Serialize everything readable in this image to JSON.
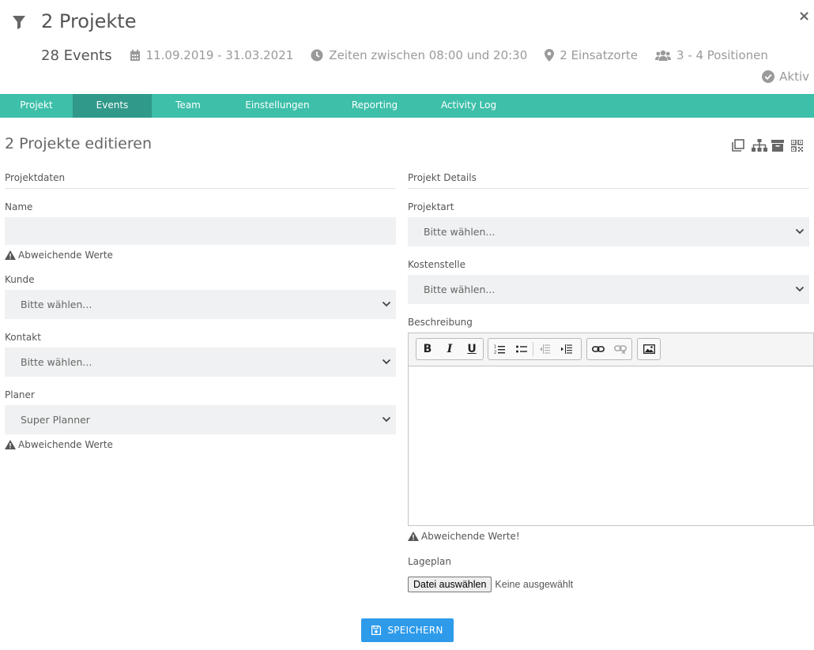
{
  "header": {
    "title": "2 Projekte",
    "events": "28 Events",
    "date_range": "11.09.2019 - 31.03.2021",
    "times": "Zeiten zwischen 08:00 und 20:30",
    "locations": "2 Einsatzorte",
    "positions": "3 - 4 Positionen",
    "status": "Aktiv",
    "close_label": "×"
  },
  "tabs": [
    {
      "label": "Projekt"
    },
    {
      "label": "Events"
    },
    {
      "label": "Team"
    },
    {
      "label": "Einstellungen"
    },
    {
      "label": "Reporting"
    },
    {
      "label": "Activity Log"
    }
  ],
  "active_tab": "Events",
  "page_title": "2 Projekte editieren",
  "left": {
    "section": "Projektdaten",
    "name": {
      "label": "Name",
      "value": "",
      "warning": "Abweichende Werte"
    },
    "kunde": {
      "label": "Kunde",
      "value": "Bitte wählen..."
    },
    "kontakt": {
      "label": "Kontakt",
      "value": "Bitte wählen..."
    },
    "planer": {
      "label": "Planer",
      "value": "Super Planner",
      "warning": "Abweichende Werte"
    }
  },
  "right": {
    "section": "Projekt Details",
    "projektart": {
      "label": "Projektart",
      "value": "Bitte wählen..."
    },
    "kostenstelle": {
      "label": "Kostenstelle",
      "value": "Bitte wählen..."
    },
    "beschreibung": {
      "label": "Beschreibung",
      "warning": "Abweichende Werte!"
    },
    "lageplan": {
      "label": "Lageplan",
      "button": "Datei auswählen",
      "status": "Keine ausgewählt"
    }
  },
  "editor_toolbar": {
    "bold": "B",
    "italic": "I",
    "underline": "U"
  },
  "save_label": "SPEICHERN",
  "colors": {
    "tab_bar": "#3dbfa9",
    "tab_active": "#30998a",
    "save_button": "#2e9bea",
    "field_bg": "#f0f1f2"
  }
}
